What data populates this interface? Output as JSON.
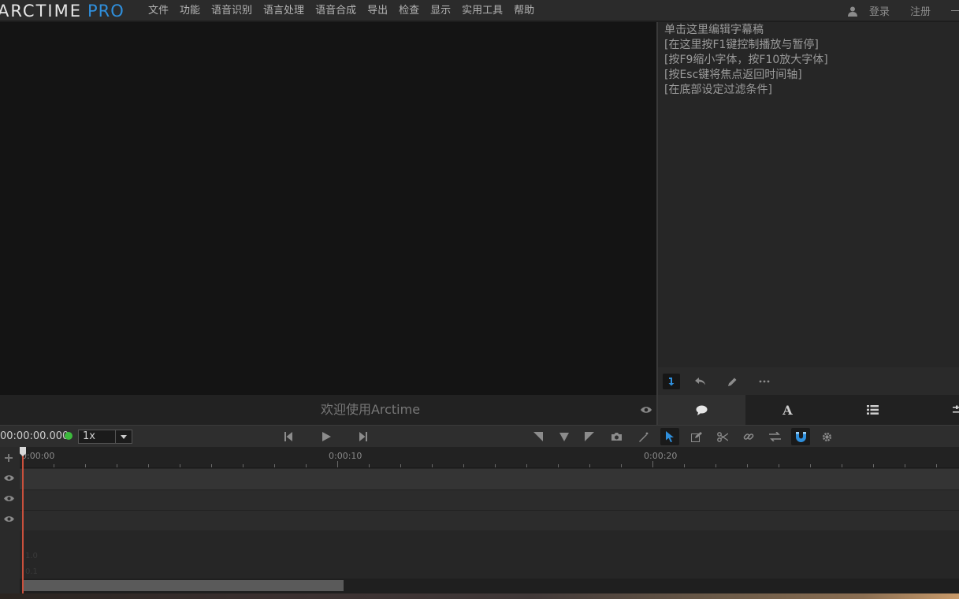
{
  "app": {
    "logo_part1": "ARCTIME",
    "logo_part2": "PRO",
    "accent": "#2f8fdc"
  },
  "menu": [
    "文件",
    "功能",
    "语音识别",
    "语言处理",
    "语音合成",
    "导出",
    "检查",
    "显示",
    "实用工具",
    "帮助"
  ],
  "user": {
    "icon": "user-icon",
    "login": "登录",
    "register": "注册"
  },
  "editor": {
    "lines": [
      "单击这里编辑字幕稿",
      "[在这里按F1键控制播放与暂停]",
      "[按F9缩小字体，按F10放大字体]",
      "[按Esc键将焦点返回时间轴]",
      "[在底部设定过滤条件]"
    ],
    "tools": [
      "insert-icon",
      "undo-icon",
      "pencil-icon",
      "more-icon"
    ]
  },
  "panel_tabs": [
    "comment-icon",
    "text-style-icon",
    "list-icon",
    "settings-sliders-icon"
  ],
  "status": {
    "welcome": "欢迎使用Arctime"
  },
  "transport": {
    "timecode": "00:00:00.000",
    "speed": "1x",
    "status_color": "#3dbb3d"
  },
  "timeline": {
    "labels": [
      "0:00:00",
      "0:00:10",
      "0:00:20"
    ],
    "ghost_lines": [
      "1.0",
      "0.1"
    ]
  }
}
